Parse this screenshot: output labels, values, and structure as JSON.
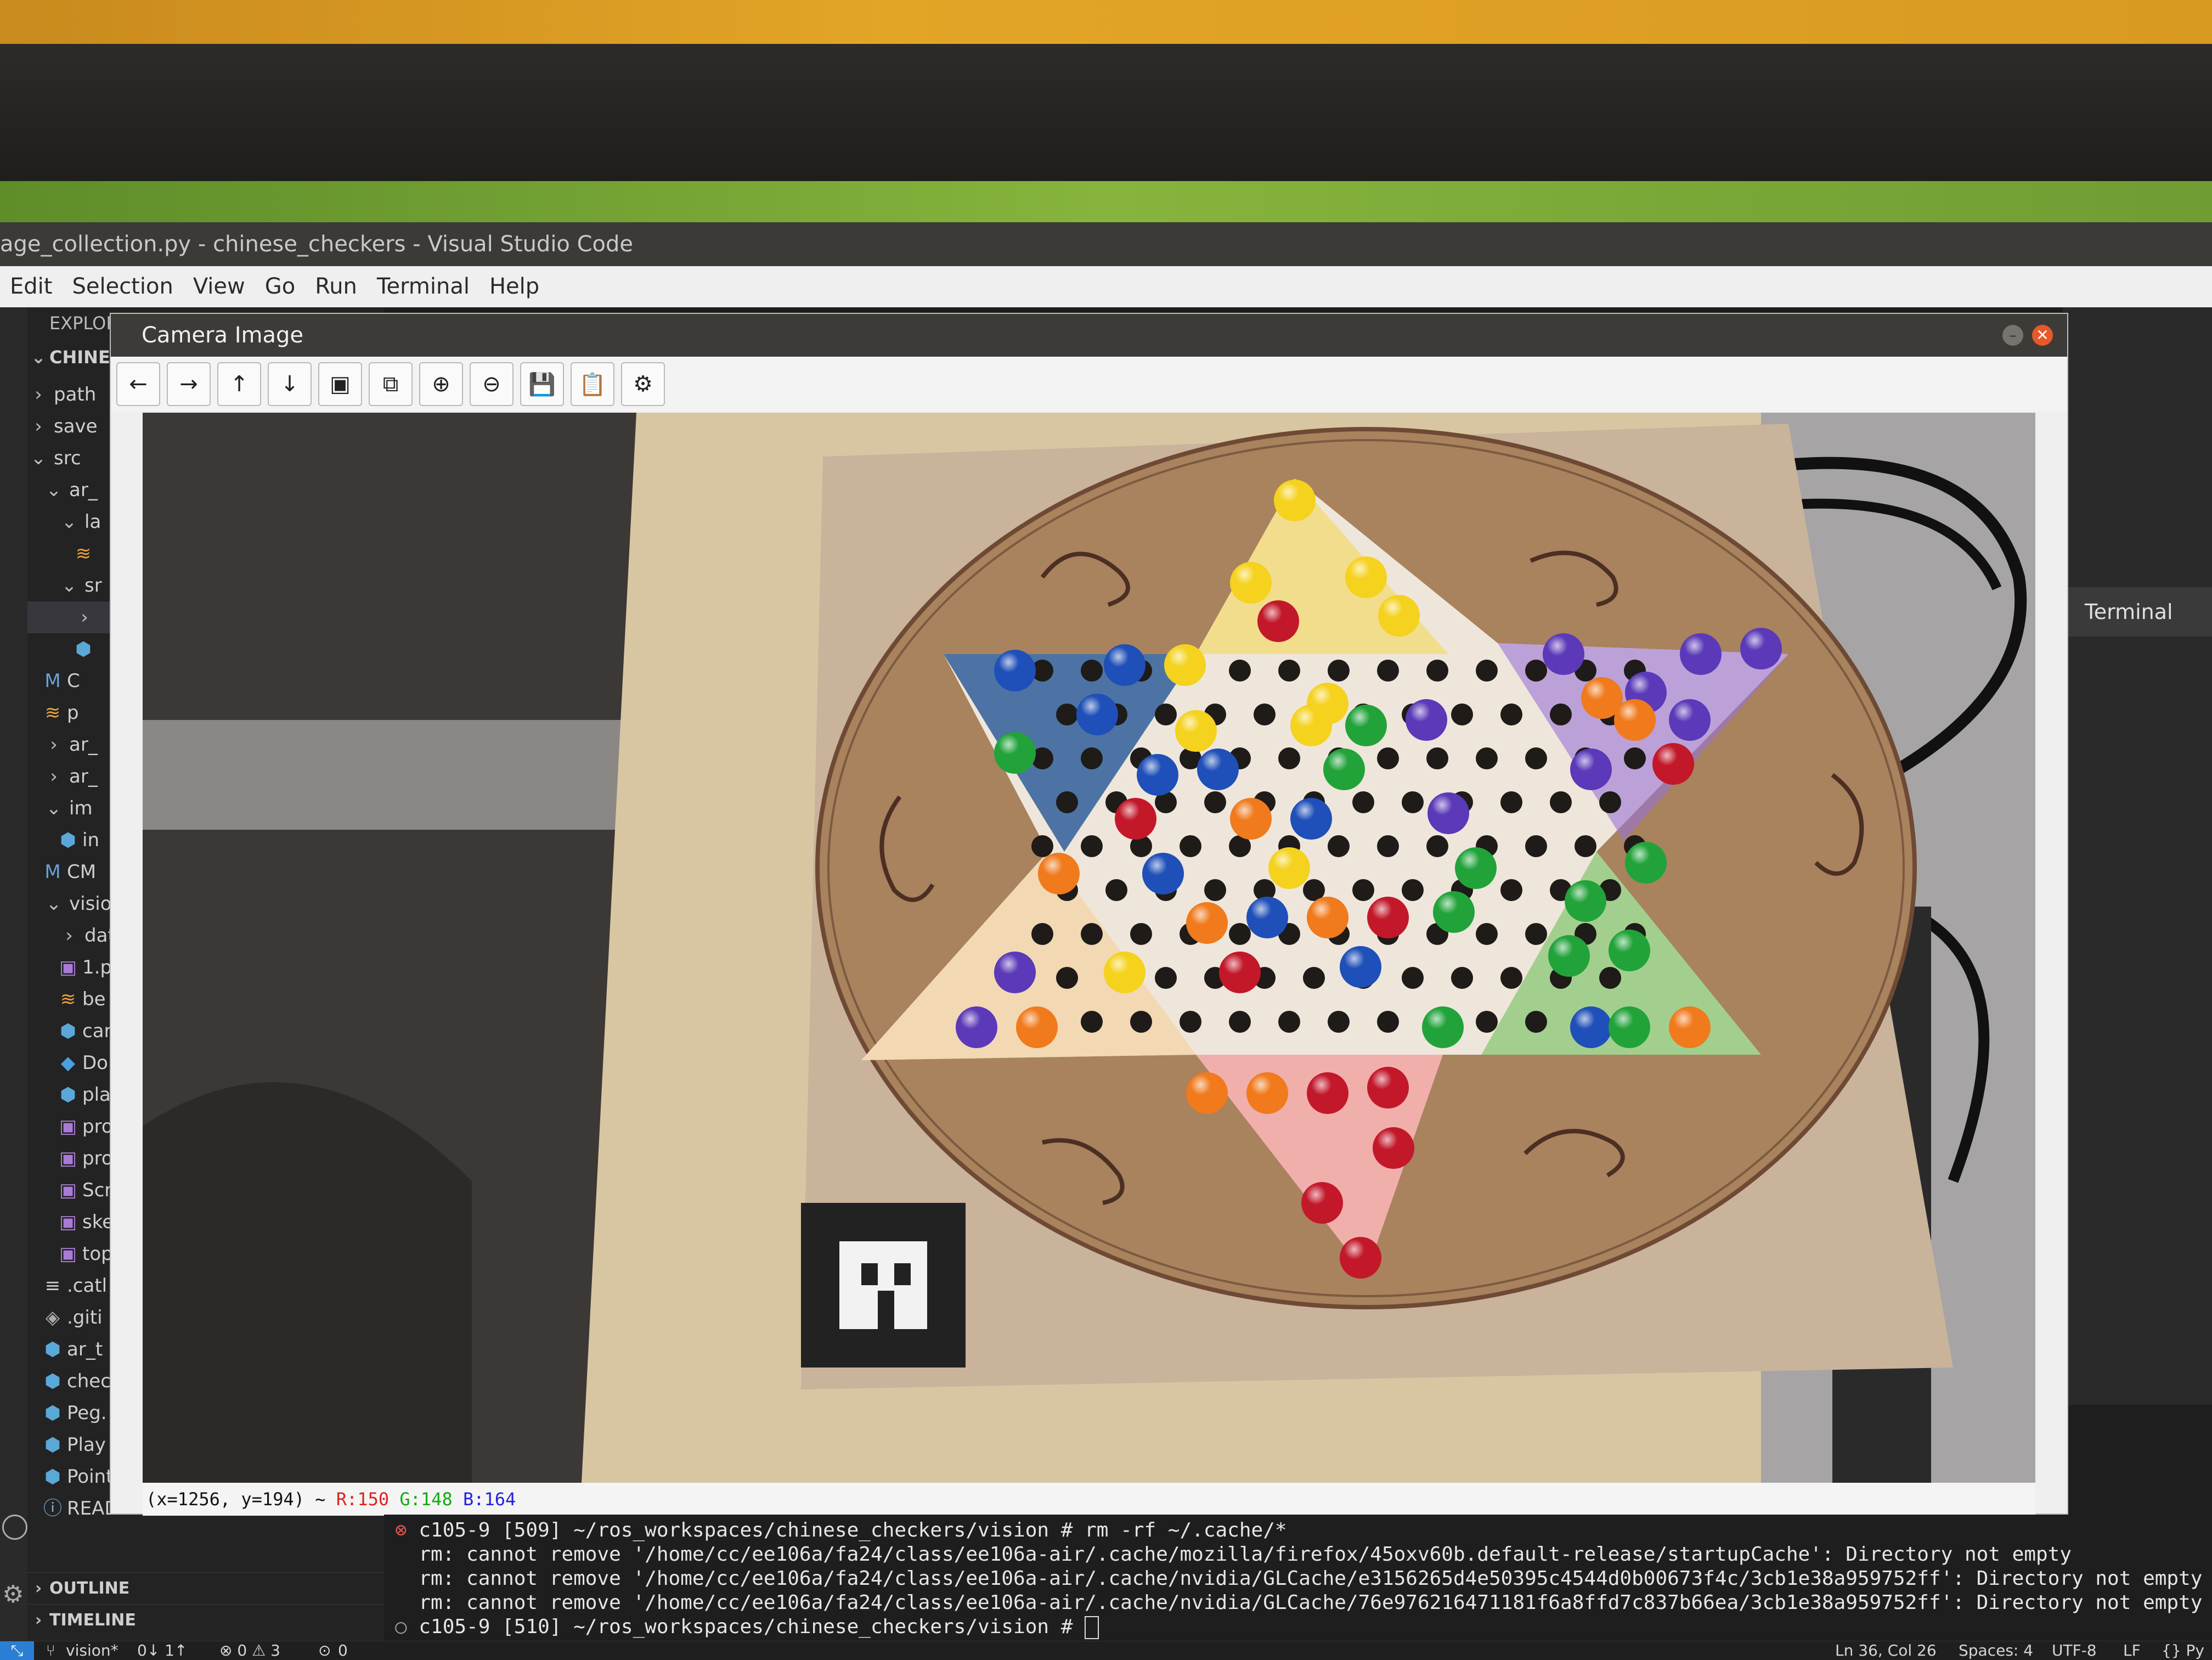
{
  "window": {
    "title": "age_collection.py - chinese_checkers - Visual Studio Code"
  },
  "menu": [
    "Edit",
    "Selection",
    "View",
    "Go",
    "Run",
    "Terminal",
    "Help"
  ],
  "explorer": {
    "header": "EXPLOR",
    "root": "CHINES",
    "rows": [
      {
        "indent": 0,
        "chev": "›",
        "icon": "",
        "label": "path"
      },
      {
        "indent": 0,
        "chev": "›",
        "icon": "",
        "label": "save"
      },
      {
        "indent": 0,
        "chev": "⌄",
        "icon": "",
        "label": "src"
      },
      {
        "indent": 1,
        "chev": "⌄",
        "icon": "",
        "label": "ar_"
      },
      {
        "indent": 2,
        "chev": "⌄",
        "icon": "",
        "label": "la"
      },
      {
        "indent": 3,
        "chev": "",
        "icon": "rss",
        "label": ""
      },
      {
        "indent": 2,
        "chev": "⌄",
        "icon": "",
        "label": "sr"
      },
      {
        "indent": 3,
        "chev": "›",
        "icon": "",
        "label": ""
      },
      {
        "indent": 3,
        "chev": "",
        "icon": "py",
        "label": ""
      },
      {
        "indent": 1,
        "chev": "",
        "icon": "M",
        "label": "C"
      },
      {
        "indent": 1,
        "chev": "",
        "icon": "rss",
        "label": "p"
      },
      {
        "indent": 1,
        "chev": "›",
        "icon": "",
        "label": "ar_"
      },
      {
        "indent": 1,
        "chev": "›",
        "icon": "",
        "label": "ar_"
      },
      {
        "indent": 1,
        "chev": "⌄",
        "icon": "",
        "label": "im"
      },
      {
        "indent": 2,
        "chev": "",
        "icon": "py",
        "label": "in"
      },
      {
        "indent": 1,
        "chev": "",
        "icon": "M",
        "label": "CM"
      },
      {
        "indent": 1,
        "chev": "⌄",
        "icon": "",
        "label": "visio"
      },
      {
        "indent": 2,
        "chev": "›",
        "icon": "",
        "label": "dat"
      },
      {
        "indent": 2,
        "chev": "",
        "icon": "img",
        "label": "1.p"
      },
      {
        "indent": 2,
        "chev": "",
        "icon": "rss",
        "label": "be"
      },
      {
        "indent": 2,
        "chev": "",
        "icon": "py",
        "label": "car"
      },
      {
        "indent": 2,
        "chev": "",
        "icon": "docker",
        "label": "Do"
      },
      {
        "indent": 2,
        "chev": "",
        "icon": "py",
        "label": "pla"
      },
      {
        "indent": 2,
        "chev": "",
        "icon": "img",
        "label": "pro"
      },
      {
        "indent": 2,
        "chev": "",
        "icon": "img",
        "label": "pro"
      },
      {
        "indent": 2,
        "chev": "",
        "icon": "img",
        "label": "Scr"
      },
      {
        "indent": 2,
        "chev": "",
        "icon": "img",
        "label": "ske"
      },
      {
        "indent": 2,
        "chev": "",
        "icon": "img",
        "label": "top"
      },
      {
        "indent": 1,
        "chev": "",
        "icon": "txt",
        "label": ".catl"
      },
      {
        "indent": 1,
        "chev": "",
        "icon": "git",
        "label": ".giti"
      },
      {
        "indent": 1,
        "chev": "",
        "icon": "py",
        "label": "ar_t"
      },
      {
        "indent": 1,
        "chev": "",
        "icon": "py",
        "label": "chec"
      },
      {
        "indent": 1,
        "chev": "",
        "icon": "py",
        "label": "Peg."
      },
      {
        "indent": 1,
        "chev": "",
        "icon": "py",
        "label": "Play"
      },
      {
        "indent": 1,
        "chev": "",
        "icon": "py",
        "label": "Point.py"
      },
      {
        "indent": 1,
        "chev": "",
        "icon": "info",
        "label": "README.md"
      }
    ],
    "outline": "OUTLINE",
    "timeline": "TIMELINE"
  },
  "camera_window": {
    "title": "Camera Image",
    "toolbar": [
      "←",
      "→",
      "↑",
      "↓",
      "▣",
      "⧉",
      "⊕",
      "⊖",
      "💾",
      "📋",
      "⚙"
    ],
    "pixel_readout": {
      "pos": "(x=1256, y=194) ~",
      "r": "R:150",
      "g": "G:148",
      "b": "B:164"
    }
  },
  "editor_panel": {
    "terminal_tab": "Terminal"
  },
  "terminal": {
    "lines": [
      {
        "marker": "⊗",
        "text": "c105-9 [509] ~/ros_workspaces/chinese_checkers/vision # rm -rf ~/.cache/*"
      },
      {
        "marker": "",
        "text": "rm: cannot remove '/home/cc/ee106a/fa24/class/ee106a-air/.cache/mozilla/firefox/45oxv60b.default-release/startupCache': Directory not empty"
      },
      {
        "marker": "",
        "text": "rm: cannot remove '/home/cc/ee106a/fa24/class/ee106a-air/.cache/nvidia/GLCache/e3156265d4e50395c4544d0b00673f4c/3cb1e38a959752ff': Directory not empty"
      },
      {
        "marker": "",
        "text": "rm: cannot remove '/home/cc/ee106a/fa24/class/ee106a-air/.cache/nvidia/GLCache/76e976216471181f6a8ffd7c837b66ea/3cb1e38a959752ff': Directory not empty"
      },
      {
        "marker": "○",
        "text": "c105-9 [510] ~/ros_workspaces/chinese_checkers/vision # "
      }
    ]
  },
  "statusbar": {
    "branch": "vision*",
    "sync": "0↓ 1↑",
    "problems": "⊗ 0 ⚠ 3",
    "ports": "0",
    "position": "Ln 36, Col 26",
    "spaces": "Spaces: 4",
    "encoding": "UTF-8",
    "eol": "LF",
    "lang": "{} Py"
  },
  "colors": {
    "blue": "#1f4fb8",
    "red": "#c2182a",
    "yellow": "#f4d21e",
    "green": "#21a33a",
    "orange": "#f07a1c",
    "purple": "#5b39b8"
  }
}
